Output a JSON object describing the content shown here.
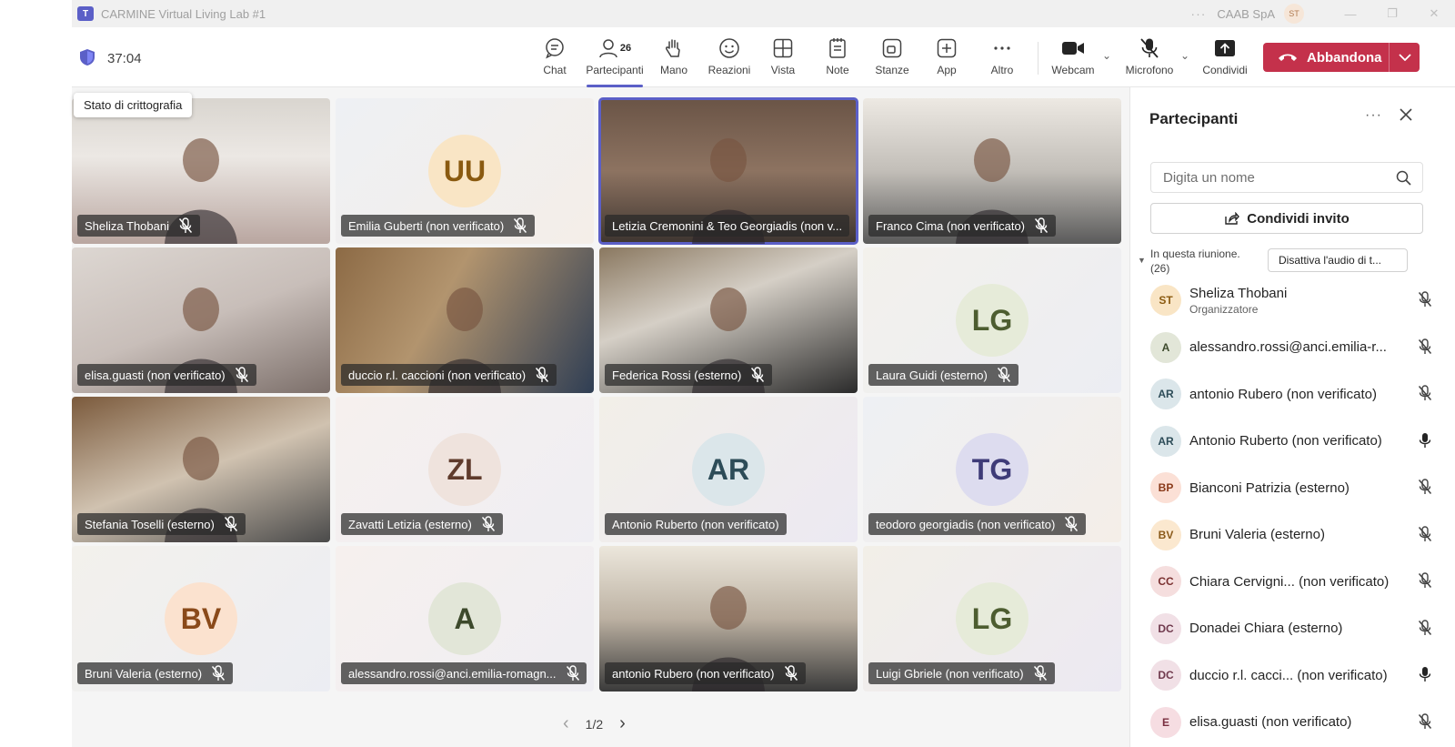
{
  "window": {
    "title": "CARMINE Virtual Living Lab #1",
    "org": "CAAB SpA",
    "org_initials": "ST",
    "more": "···",
    "minimize": "—",
    "maximize": "❐",
    "close": "✕"
  },
  "toolbar": {
    "timer": "37:04",
    "participants_count": "26",
    "items": [
      {
        "label": "Chat",
        "icon": "chat-icon"
      },
      {
        "label": "Partecipanti",
        "icon": "people-icon"
      },
      {
        "label": "Mano",
        "icon": "hand-icon"
      },
      {
        "label": "Reazioni",
        "icon": "smiley-icon"
      },
      {
        "label": "Vista",
        "icon": "grid-icon"
      },
      {
        "label": "Note",
        "icon": "notes-icon"
      },
      {
        "label": "Stanze",
        "icon": "rooms-icon"
      },
      {
        "label": "App",
        "icon": "plus-icon"
      },
      {
        "label": "Altro",
        "icon": "more-icon"
      },
      {
        "label": "Webcam",
        "icon": "camera-icon"
      },
      {
        "label": "Microfono",
        "icon": "mic-off-icon"
      },
      {
        "label": "Condividi",
        "icon": "share-icon"
      }
    ],
    "leave_label": "Abbandona",
    "encryption_tooltip": "Stato di crittografia"
  },
  "colors": {
    "accent": "#5b5fc7",
    "leave": "#c4314b"
  },
  "tiles": [
    {
      "name": "Sheliza Thobani",
      "type": "video"
    },
    {
      "name": "Emilia Guberti (non verificato)",
      "type": "avatar",
      "initials": "UU"
    },
    {
      "name": "Letizia Cremonini & Teo Georgiadis (non v...",
      "type": "video",
      "selected": true
    },
    {
      "name": "Franco Cima (non verificato)",
      "type": "video"
    },
    {
      "name": "elisa.guasti (non verificato)",
      "type": "video"
    },
    {
      "name": "duccio r.l. caccioni (non verificato)",
      "type": "video"
    },
    {
      "name": "Federica Rossi (esterno)",
      "type": "video"
    },
    {
      "name": "Laura Guidi (esterno)",
      "type": "avatar",
      "initials": "LG"
    },
    {
      "name": "Stefania Toselli (esterno)",
      "type": "video"
    },
    {
      "name": "Zavatti Letizia (esterno)",
      "type": "avatar",
      "initials": "ZL"
    },
    {
      "name": "Antonio Ruberto (non verificato)",
      "type": "avatar",
      "initials": "AR"
    },
    {
      "name": "teodoro georgiadis (non verificato)",
      "type": "avatar",
      "initials": "TG"
    },
    {
      "name": "Bruni Valeria (esterno)",
      "type": "avatar",
      "initials": "BV"
    },
    {
      "name": "alessandro.rossi@anci.emilia-romagn...",
      "type": "avatar",
      "initials": "A"
    },
    {
      "name": "antonio Rubero (non verificato)",
      "type": "video"
    },
    {
      "name": "Luigi Gbriele (non verificato)",
      "type": "avatar",
      "initials": "LG"
    }
  ],
  "pager": {
    "label": "1/2",
    "prev": "‹",
    "next": "›"
  },
  "panel": {
    "title": "Partecipanti",
    "search_placeholder": "Digita un nome",
    "invite_label": "Condividi invito",
    "section_label": "In questa riunione. (26)",
    "mute_all_label": "Disattiva l'audio di t...",
    "people": [
      {
        "initials": "ST",
        "name": "Sheliza Thobani",
        "suffix": "",
        "role": "Organizzatore",
        "mic": "off"
      },
      {
        "initials": "A",
        "name": "alessandro.rossi@anci.emilia-r...",
        "suffix": "",
        "role": "",
        "mic": "off"
      },
      {
        "initials": "AR",
        "name": "antonio Rubero",
        "suffix": "(non verificato)",
        "role": "",
        "mic": "off"
      },
      {
        "initials": "AR",
        "name": "Antonio Ruberto",
        "suffix": "(non verificato)",
        "role": "",
        "mic": "on"
      },
      {
        "initials": "BP",
        "name": "Bianconi Patrizia",
        "suffix": "(esterno)",
        "role": "",
        "mic": "off"
      },
      {
        "initials": "BV",
        "name": "Bruni Valeria",
        "suffix": "(esterno)",
        "role": "",
        "mic": "off"
      },
      {
        "initials": "CC",
        "name": "Chiara Cervigni...",
        "suffix": "(non verificato)",
        "role": "",
        "mic": "off"
      },
      {
        "initials": "DC",
        "name": "Donadei Chiara",
        "suffix": "(esterno)",
        "role": "",
        "mic": "off"
      },
      {
        "initials": "DC",
        "name": "duccio r.l. cacci...",
        "suffix": "(non verificato)",
        "role": "",
        "mic": "on"
      },
      {
        "initials": "E",
        "name": "elisa.guasti",
        "suffix": "(non verificato)",
        "role": "",
        "mic": "off"
      }
    ]
  }
}
